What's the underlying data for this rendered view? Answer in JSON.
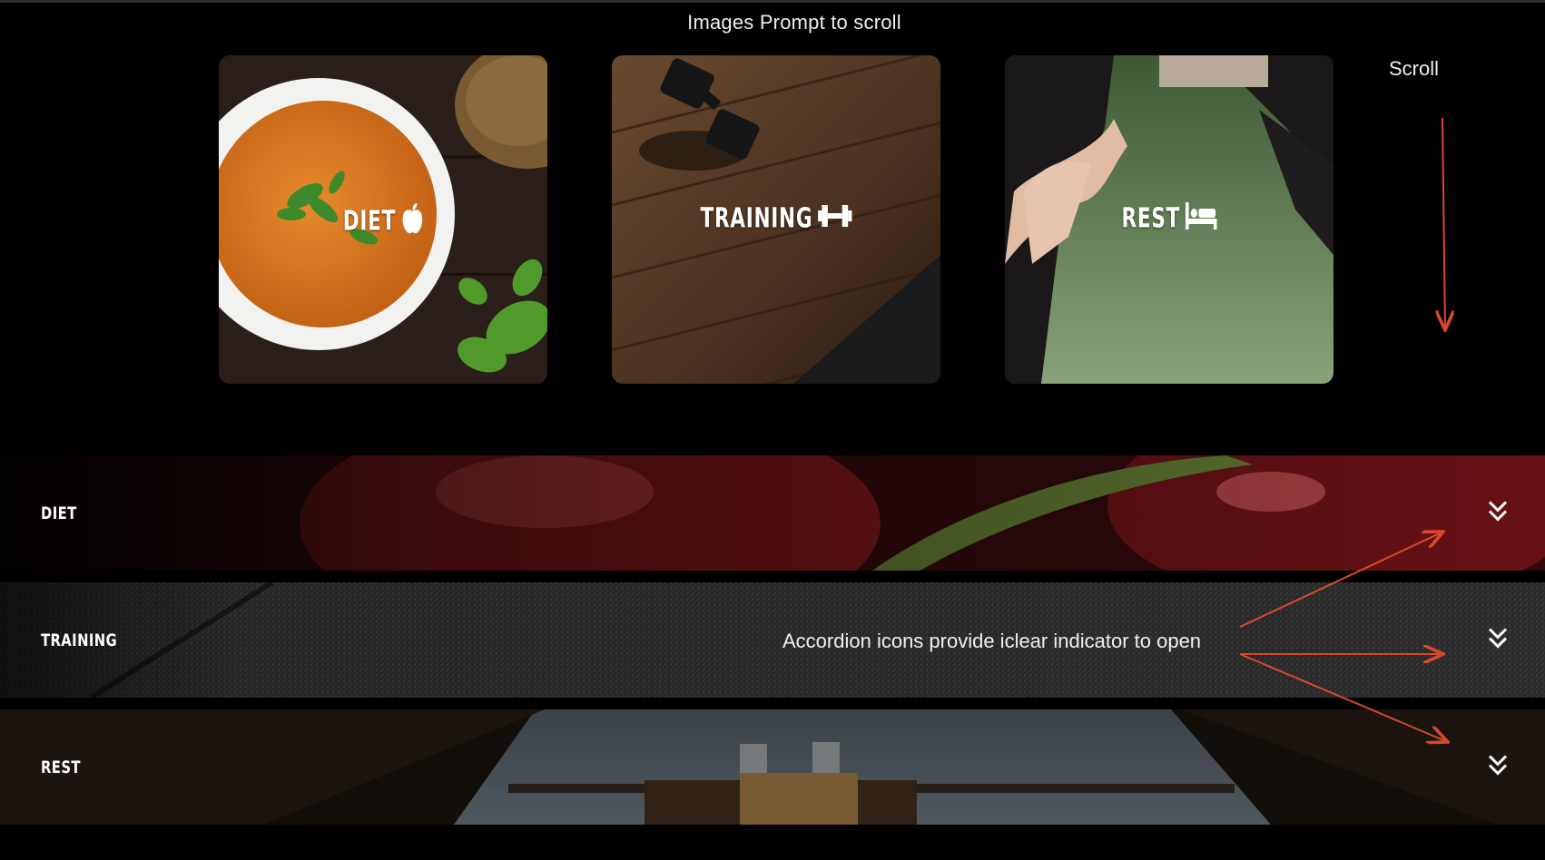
{
  "header": {
    "title": "Images Prompt to scroll"
  },
  "scroll_hint": {
    "label": "Scroll"
  },
  "cards": [
    {
      "label": "DIET",
      "icon": "apple-icon"
    },
    {
      "label": "TRAINING",
      "icon": "dumbbell-icon"
    },
    {
      "label": "REST",
      "icon": "bed-icon"
    }
  ],
  "accordion": [
    {
      "title": "DIET",
      "icon": "chevron-double-down-icon"
    },
    {
      "title": "TRAINING",
      "icon": "chevron-double-down-icon"
    },
    {
      "title": "REST",
      "icon": "chevron-double-down-icon"
    }
  ],
  "annotation": {
    "text": "Accordion icons provide iclear indicator to open"
  },
  "colors": {
    "background": "#000000",
    "annotation_arrow": "#d9482b",
    "text": "#ffffff"
  }
}
